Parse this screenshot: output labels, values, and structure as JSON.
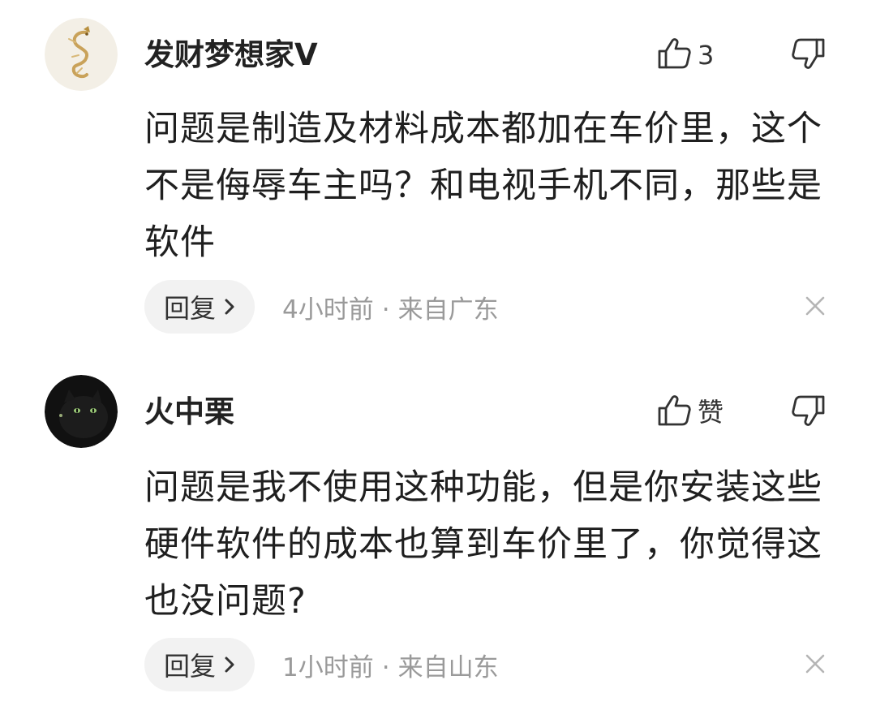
{
  "comments": [
    {
      "username": "发财梦想家V",
      "like_label": "3",
      "text": "问题是制造及材料成本都加在车价里，这个不是侮辱车主吗？和电视手机不同，那些是软件",
      "reply_label": "回复",
      "time": "4小时前",
      "dot": "·",
      "location": "来自广东",
      "avatar_icon": "dragon-avatar",
      "colors": {
        "avatar_bg": "#f3efe6",
        "avatar_accent": "#c9a25a"
      }
    },
    {
      "username": "火中栗",
      "like_label": "赞",
      "text": "问题是我不使用这种功能，但是你安装这些硬件软件的成本也算到车价里了，你觉得这也没问题?",
      "reply_label": "回复",
      "time": "1小时前",
      "dot": "·",
      "location": "来自山东",
      "avatar_icon": "black-cat-avatar",
      "colors": {
        "avatar_bg": "#111111",
        "avatar_accent": "#9fcf7a"
      }
    }
  ],
  "icons": {
    "like": "thumbs-up-icon",
    "dislike": "thumbs-down-icon",
    "reply_chevron": "chevron-right-icon",
    "dismiss": "close-icon"
  }
}
